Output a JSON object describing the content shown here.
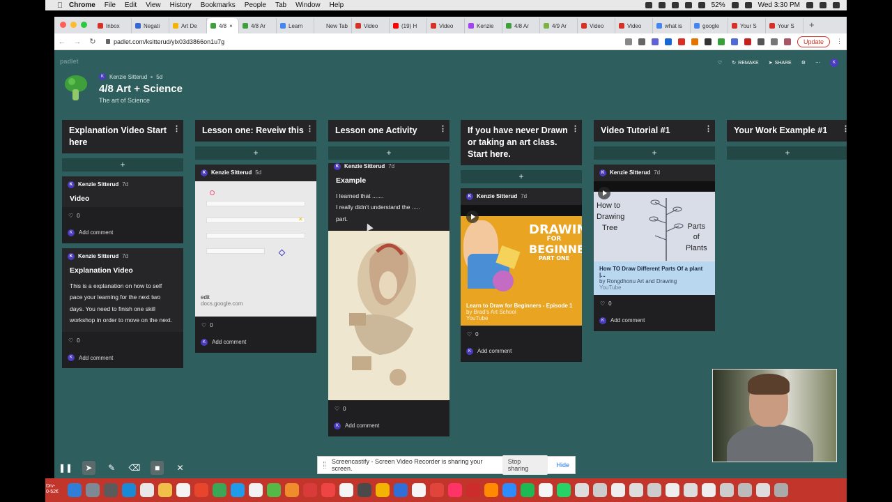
{
  "menubar": {
    "app": "Chrome",
    "items": [
      "File",
      "Edit",
      "View",
      "History",
      "Bookmarks",
      "People",
      "Tab",
      "Window",
      "Help"
    ],
    "battery": "52%",
    "clock": "Wed 3:30 PM"
  },
  "browser": {
    "tabs": [
      {
        "label": "Inbox",
        "color": "#d93025"
      },
      {
        "label": "Negati",
        "color": "#3367d6"
      },
      {
        "label": "Art De",
        "color": "#f4b400"
      },
      {
        "label": "4/8",
        "color": "#3f9f3a",
        "active": true
      },
      {
        "label": "4/8 Ar",
        "color": "#3f9f3a"
      },
      {
        "label": "Learn",
        "color": "#4285f4"
      },
      {
        "label": "New Tab",
        "color": "#dfe1e5"
      },
      {
        "label": "Video",
        "color": "#d93025"
      },
      {
        "label": "(19) H",
        "color": "#ff0000"
      },
      {
        "label": "Video",
        "color": "#d93025"
      },
      {
        "label": "Kenzie",
        "color": "#a142f4"
      },
      {
        "label": "4/8 Ar",
        "color": "#3f9f3a"
      },
      {
        "label": "4/9 Ar",
        "color": "#7cb342"
      },
      {
        "label": "Video",
        "color": "#d93025"
      },
      {
        "label": "Video",
        "color": "#d93025"
      },
      {
        "label": "what is",
        "color": "#4285f4"
      },
      {
        "label": "google",
        "color": "#4285f4"
      },
      {
        "label": "Your S",
        "color": "#d93025"
      },
      {
        "label": "Your S",
        "color": "#d93025"
      }
    ],
    "url": "padlet.com/ksitterud/ylx03d3866on1u7g",
    "update_label": "Update"
  },
  "board": {
    "logo": "padlet",
    "author": "Kenzie Sitterud",
    "age": "5d",
    "title": "4/8 Art + Science",
    "subtitle": "The art of Science",
    "actions": {
      "remake": "REMAKE",
      "share": "SHARE"
    }
  },
  "columns": [
    {
      "title": "Explanation Video Start here",
      "posts": [
        {
          "author": "Kenzie Sitterud",
          "age": "7d",
          "title": "Video",
          "likes": "0",
          "comment": "Add comment"
        },
        {
          "author": "Kenzie Sitterud",
          "age": "7d",
          "title": "Explanation Video",
          "body": "This is a explanation on how to self pace your learning for the next two days. You need to finish one skill workshop in order to move on the next.",
          "likes": "0",
          "comment": "Add comment"
        }
      ]
    },
    {
      "title": "Lesson one: Reveiw this",
      "posts": [
        {
          "author": "Kenzie Sitterud",
          "age": "5d",
          "link_title": "edit",
          "link_source": "docs.google.com",
          "likes": "0",
          "comment": "Add comment"
        }
      ]
    },
    {
      "title": "Lesson one Activity",
      "posts": [
        {
          "author": "Kenzie Sitterud",
          "age": "7d",
          "title": "Example",
          "body_lines": [
            "I learned that .......",
            "I really didn't understand the .....",
            "part."
          ],
          "likes": "0",
          "comment": "Add comment"
        }
      ]
    },
    {
      "title": "If you have never Drawn or taking an art class. Start here.",
      "posts": [
        {
          "author": "Kenzie Sitterud",
          "age": "7d",
          "thumb_title": "DRAWING",
          "thumb_for": "FOR",
          "thumb_sub": "BEGINNERS",
          "thumb_part": "PART ONE",
          "video_title": "Learn to Draw for Beginners - Episode 1",
          "video_by": "by Brad's Art School",
          "video_source": "YouTube",
          "likes": "0",
          "comment": "Add comment"
        }
      ]
    },
    {
      "title": "Video Tutorial #1",
      "posts": [
        {
          "author": "Kenzie Sitterud",
          "age": "7d",
          "thumb_text": [
            "How to",
            "Drawing",
            "Tree"
          ],
          "thumb_right": [
            "Parts",
            "of",
            "Plants"
          ],
          "video_title": "How TO Draw Different Parts Of a plant |...",
          "video_by": "by Rongdhonu Art and Drawing",
          "video_source": "YouTube",
          "likes": "0",
          "comment": "Add comment"
        }
      ]
    },
    {
      "title": "Your Work Example #1",
      "posts": []
    }
  ],
  "screencastify": {
    "message": "Screencastify - Screen Video Recorder is sharing your screen.",
    "stop": "Stop sharing",
    "hide": "Hide"
  },
  "dock": {
    "label_lines": [
      "Drv-",
      "0-52€"
    ]
  }
}
